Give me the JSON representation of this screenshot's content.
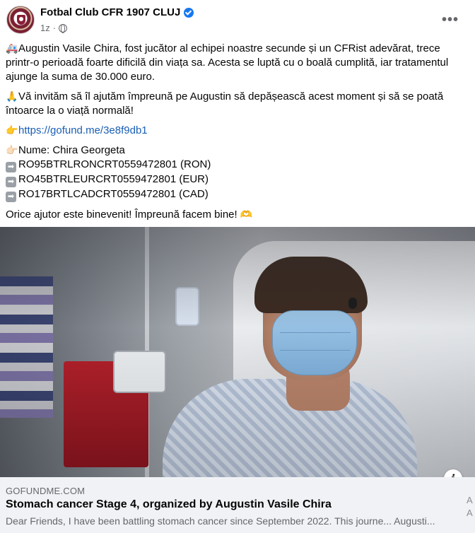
{
  "header": {
    "page_name": "Fotbal Club CFR 1907 CLUJ",
    "timestamp": "1z",
    "separator": "·",
    "more_label": "•••",
    "verified": true
  },
  "post": {
    "p1_emoji": "🚑",
    "p1_line1": "Augustin Vasile Chira, fost jucător al echipei noastre secunde și un CFRist adevărat, trece",
    "p1_line2": "printr-o perioadă foarte dificilă din viața sa. Acesta se luptă cu o boală cumplită, iar tratamentul",
    "p1_line3": "ajunge la suma de 30.000 euro.",
    "p2_emoji": "🙏",
    "p2_line1": "Vă invităm să îl ajutăm împreună pe Augustin să depășească acest moment și să se poată",
    "p2_line2": "întoarce la o viață normală!",
    "link_emoji": "👉",
    "link_url": "https://gofund.me/3e8f9db1",
    "name_emoji": "👉🏻",
    "name_line": "Nume: Chira Georgeta",
    "arrow_glyph": "➡",
    "iban_ron": "RO95BTRLRONCRT0559472801 (RON)",
    "iban_eur": "RO45BTRLEURCRT0559472801 (EUR)",
    "iban_cad": "RO17BRTLCADCRT0559472801 (CAD)",
    "closing": "Orice ajutor este binevenit! Împreună facem bine!",
    "closing_emoji": "🫶"
  },
  "link_preview": {
    "domain": "GOFUNDME.COM",
    "title": "Stomach cancer Stage 4, organized by Augustin Vasile Chira",
    "description": "Dear Friends, I have been battling stomach cancer since September 2022. This journe... Augusti...",
    "info_label": "i",
    "edge_text_1": "A",
    "edge_text_2": "A"
  },
  "icons": {
    "globe": "globe-icon",
    "verified": "verified-badge-icon",
    "info": "info-icon"
  },
  "colors": {
    "link": "#1a5fb4",
    "verified": "#1877f2",
    "card_bg": "#f0f2f5",
    "muted_text": "#65676b"
  }
}
